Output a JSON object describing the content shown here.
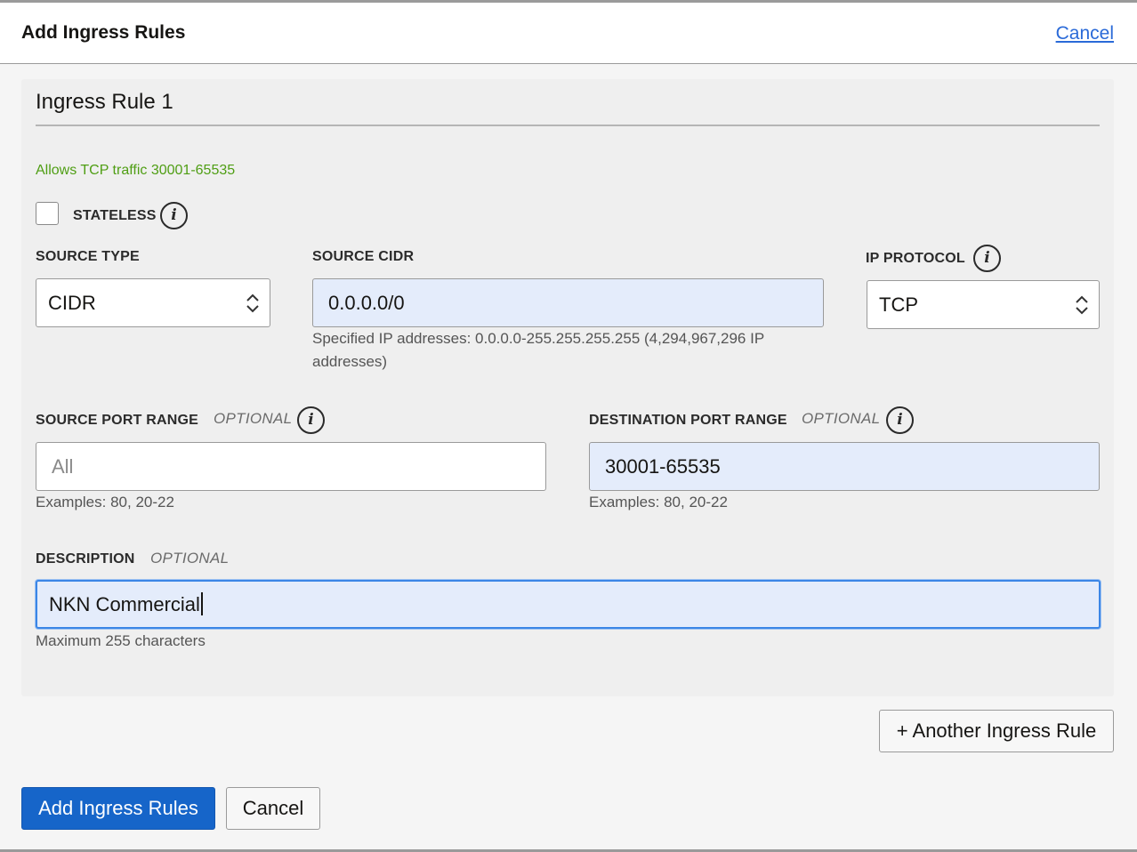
{
  "header": {
    "title": "Add Ingress Rules",
    "cancel_link": "Cancel"
  },
  "rule": {
    "title": "Ingress Rule 1",
    "summary": "Allows TCP traffic 30001-65535",
    "stateless": {
      "label": "STATELESS",
      "checked": false
    },
    "source_type": {
      "label": "SOURCE TYPE",
      "value": "CIDR"
    },
    "source_cidr": {
      "label": "SOURCE CIDR",
      "value": "0.0.0.0/0",
      "hint_line1": "Specified IP addresses: 0.0.0.0-255.255.255.255 (4,294,967,296 IP",
      "hint_line2": "addresses)"
    },
    "ip_protocol": {
      "label": "IP PROTOCOL",
      "value": "TCP"
    },
    "source_port_range": {
      "label": "SOURCE PORT RANGE",
      "optional": "OPTIONAL",
      "value": "",
      "placeholder": "All",
      "hint": "Examples: 80, 20-22"
    },
    "destination_port_range": {
      "label": "DESTINATION PORT RANGE",
      "optional": "OPTIONAL",
      "value": "30001-65535",
      "hint": "Examples: 80, 20-22"
    },
    "description": {
      "label": "DESCRIPTION",
      "optional": "OPTIONAL",
      "value": "NKN Commercial",
      "hint": "Maximum 255 characters"
    }
  },
  "buttons": {
    "another_rule": "+ Another Ingress Rule",
    "submit": "Add Ingress Rules",
    "cancel": "Cancel"
  },
  "icons": {
    "info": "info-icon",
    "select_caret": "chevron-up-down-icon"
  },
  "colors": {
    "primary": "#1665c9",
    "link": "#2a6ad8",
    "success_text": "#4f9e14",
    "filled_input": "#e4ecfb",
    "focus_ring": "#3b86e6"
  }
}
